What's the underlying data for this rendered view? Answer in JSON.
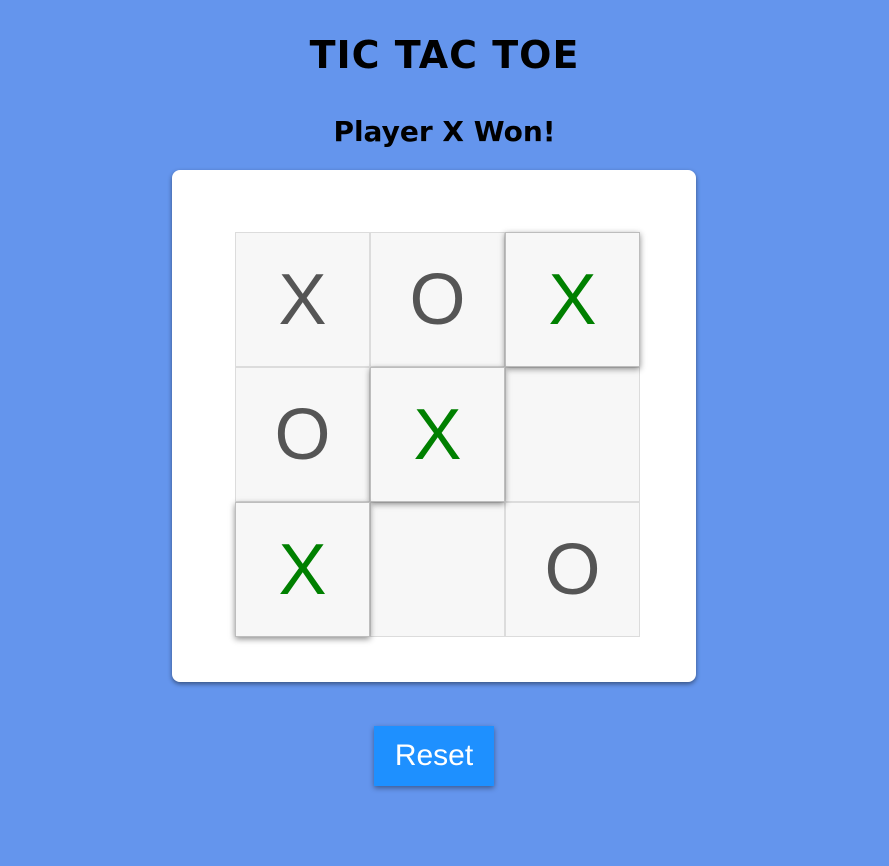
{
  "game": {
    "title": "TIC TAC TOE",
    "status": "Player X Won!",
    "winner": "X",
    "board": [
      [
        "X",
        "O",
        "X"
      ],
      [
        "O",
        "X",
        ""
      ],
      [
        "X",
        "",
        "O"
      ]
    ],
    "winning_cells": [
      [
        0,
        2
      ],
      [
        1,
        1
      ],
      [
        2,
        0
      ]
    ],
    "reset_label": "Reset"
  },
  "colors": {
    "background": "#6495ed",
    "panel": "#ffffff",
    "cell": "#f7f7f7",
    "mark": "#555555",
    "winning_mark": "#008000",
    "reset_button": "#1e90ff",
    "reset_text": "#ffffff"
  }
}
